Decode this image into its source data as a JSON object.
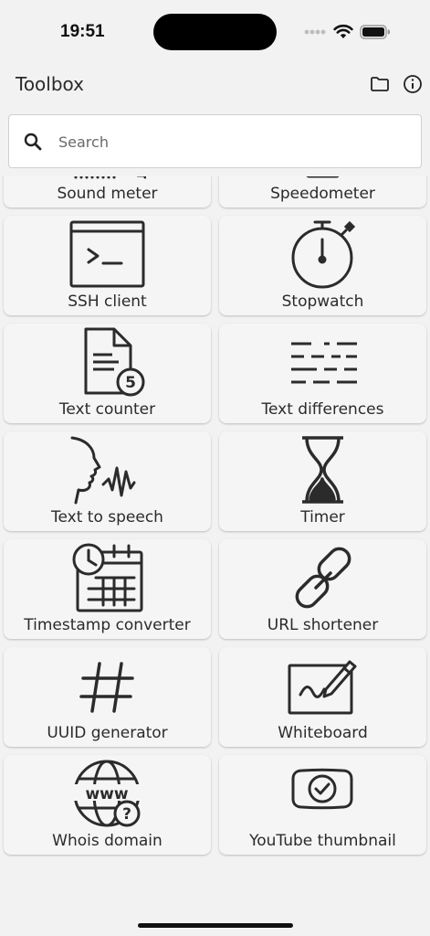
{
  "status": {
    "time": "19:51"
  },
  "header": {
    "title": "Toolbox",
    "icons": [
      "folder-icon",
      "info-icon"
    ]
  },
  "search": {
    "placeholder": "Search",
    "value": ""
  },
  "tools": [
    {
      "label": "Sound meter",
      "icon": "sound-meter-icon"
    },
    {
      "label": "Speedometer",
      "icon": "speedometer-icon"
    },
    {
      "label": "SSH client",
      "icon": "terminal-icon"
    },
    {
      "label": "Stopwatch",
      "icon": "stopwatch-icon"
    },
    {
      "label": "Text counter",
      "icon": "document-count-icon",
      "badge": "5"
    },
    {
      "label": "Text differences",
      "icon": "text-diff-icon"
    },
    {
      "label": "Text to speech",
      "icon": "speaking-head-icon"
    },
    {
      "label": "Timer",
      "icon": "hourglass-icon"
    },
    {
      "label": "Timestamp converter",
      "icon": "calendar-clock-icon"
    },
    {
      "label": "URL shortener",
      "icon": "link-icon"
    },
    {
      "label": "UUID generator",
      "icon": "hash-icon"
    },
    {
      "label": "Whiteboard",
      "icon": "whiteboard-icon"
    },
    {
      "label": "Whois domain",
      "icon": "globe-www-icon",
      "badge": "?"
    },
    {
      "label": "YouTube thumbnail",
      "icon": "youtube-check-icon"
    }
  ]
}
